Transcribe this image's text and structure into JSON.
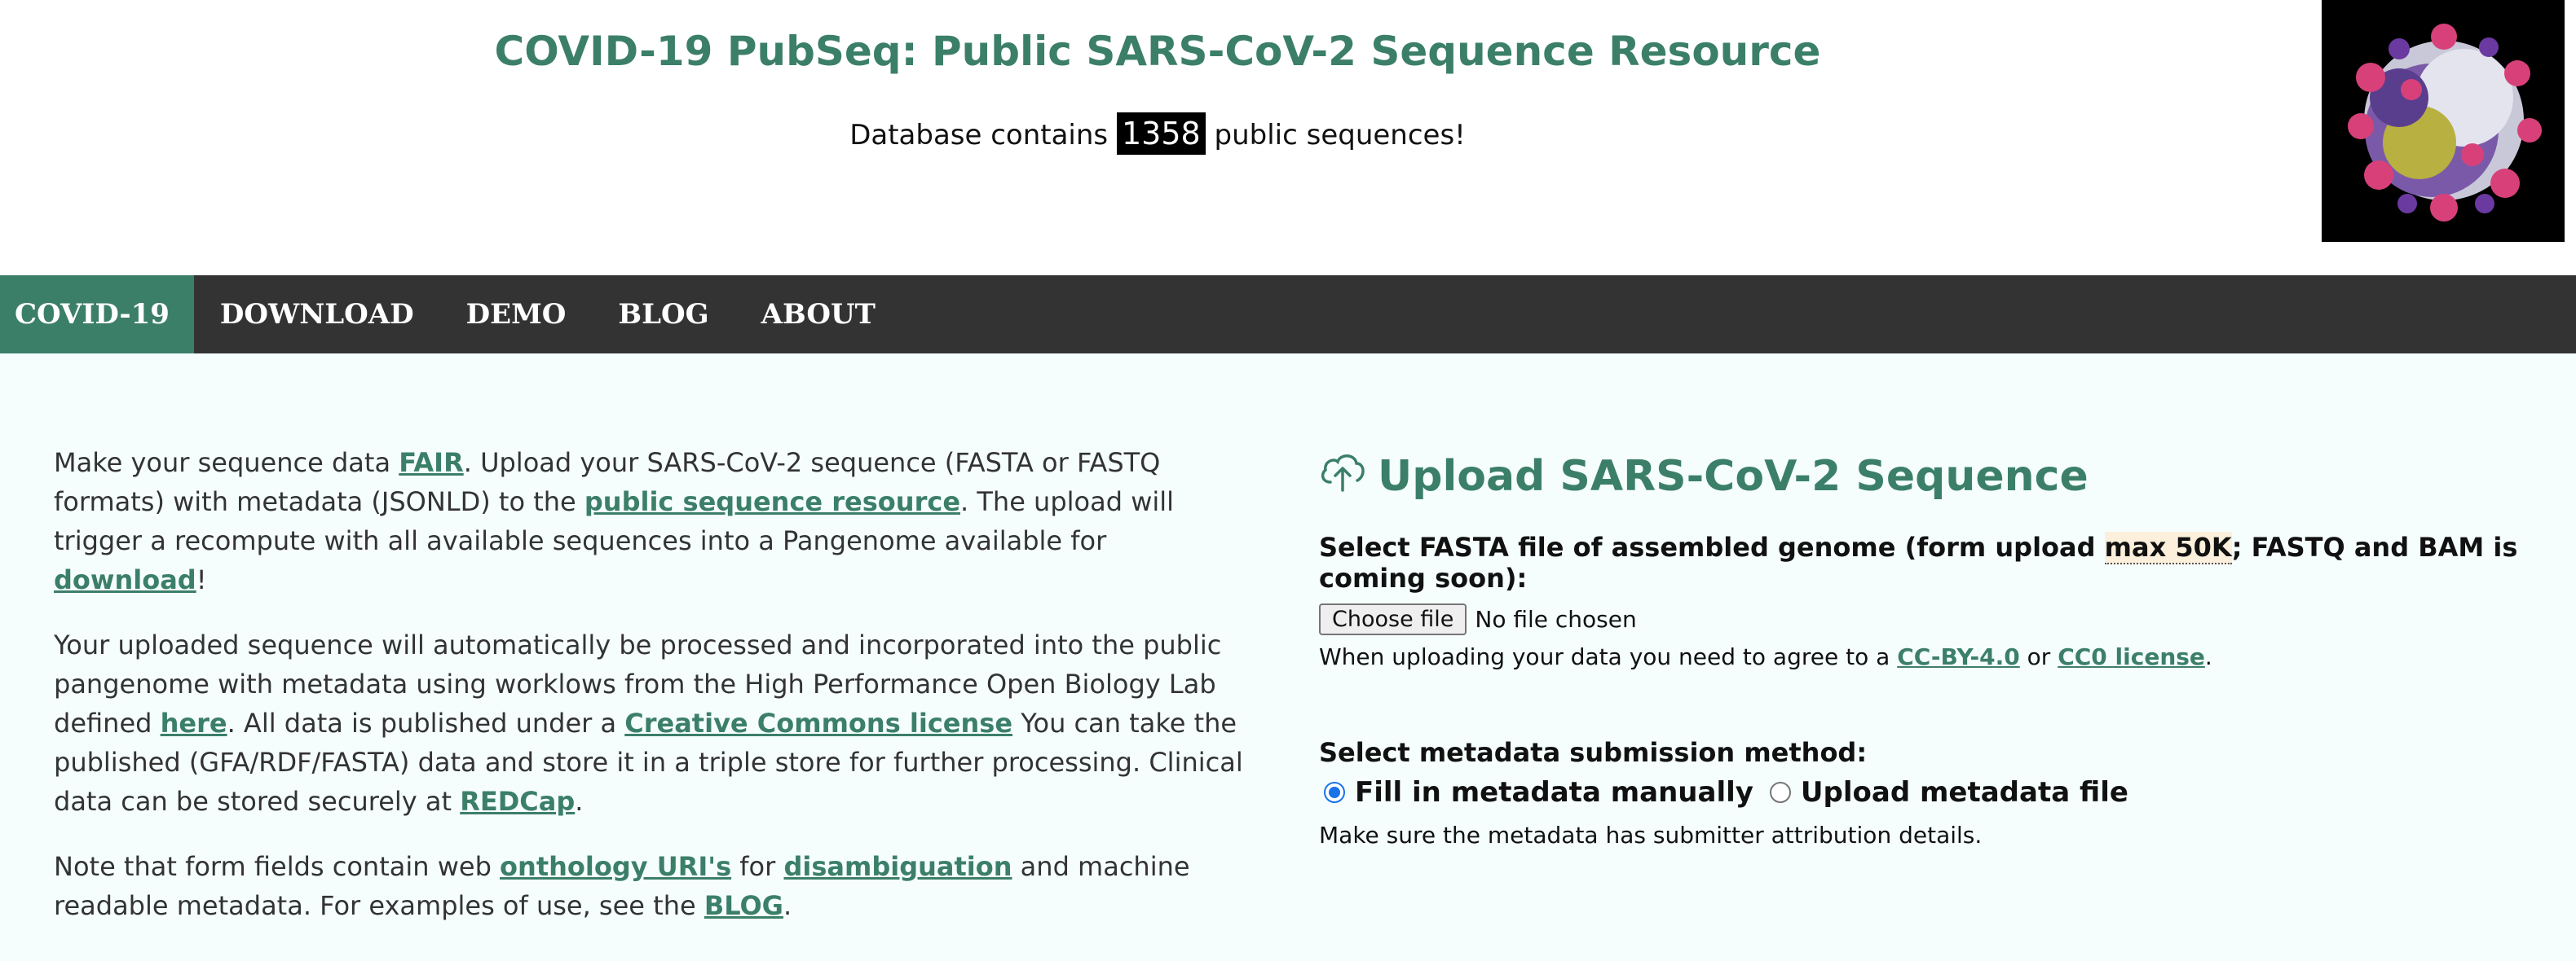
{
  "header": {
    "title": "COVID-19 PubSeq: Public SARS-CoV-2 Sequence Resource",
    "count_prefix": "Database contains",
    "count_value": "1358",
    "count_suffix": "public sequences!",
    "virus_image_icon": "coronavirus-image"
  },
  "nav": {
    "items": [
      "COVID-19",
      "DOWNLOAD",
      "DEMO",
      "BLOG",
      "ABOUT"
    ],
    "active": "COVID-19"
  },
  "intro": {
    "p1": {
      "t1": "Make your sequence data ",
      "l1": "FAIR",
      "t2": ". Upload your SARS-CoV-2 sequence (FASTA or FASTQ formats) with metadata (JSONLD) to the ",
      "l2": "public sequence resource",
      "t3": ". The upload will trigger a recompute with all available sequences into a Pangenome available for ",
      "l3": "download",
      "t4": "!"
    },
    "p2": {
      "t1": "Your uploaded sequence will automatically be processed and incorporated into the public pangenome with metadata using worklows from the High Performance Open Biology Lab defined ",
      "l1": "here",
      "t2": ". All data is published under a ",
      "l2": "Creative Commons license",
      "t3": " You can take the published (GFA/RDF/FASTA) data and store it in a triple store for further processing. Clinical data can be stored securely at ",
      "l3": "REDCap",
      "t4": "."
    },
    "p3": {
      "t1": "Note that form fields contain web ",
      "l1": "onthology URI's",
      "t2": " for ",
      "l2": "disambiguation",
      "t3": " and machine readable metadata. For examples of use, see the ",
      "l3": "BLOG",
      "t4": "."
    }
  },
  "upload": {
    "icon": "cloud-upload-icon",
    "title": "Upload SARS-CoV-2 Sequence",
    "fasta_label_1": "Select FASTA file of assembled genome (form upload ",
    "fasta_label_max": "max 50K",
    "fasta_label_2": "; FASTQ and BAM is coming soon):",
    "choose_button": "Choose file",
    "file_status": "No file chosen",
    "agree_text_1": "When uploading your data you need to agree to a ",
    "license_1": "CC-BY-4.0",
    "agree_or": " or ",
    "license_2": "CC0 license",
    "agree_end": ".",
    "metadata_label": "Select metadata submission method:",
    "option_manual": "Fill in metadata manually",
    "option_file": "Upload metadata file",
    "selected_option": "Fill in metadata manually",
    "note": "Make sure the metadata has submitter attribution details."
  },
  "colors": {
    "accent": "#3c7f69",
    "nav_bg": "#333333",
    "main_bg": "#f5fefd",
    "radio_selected": "#1a73e8"
  }
}
